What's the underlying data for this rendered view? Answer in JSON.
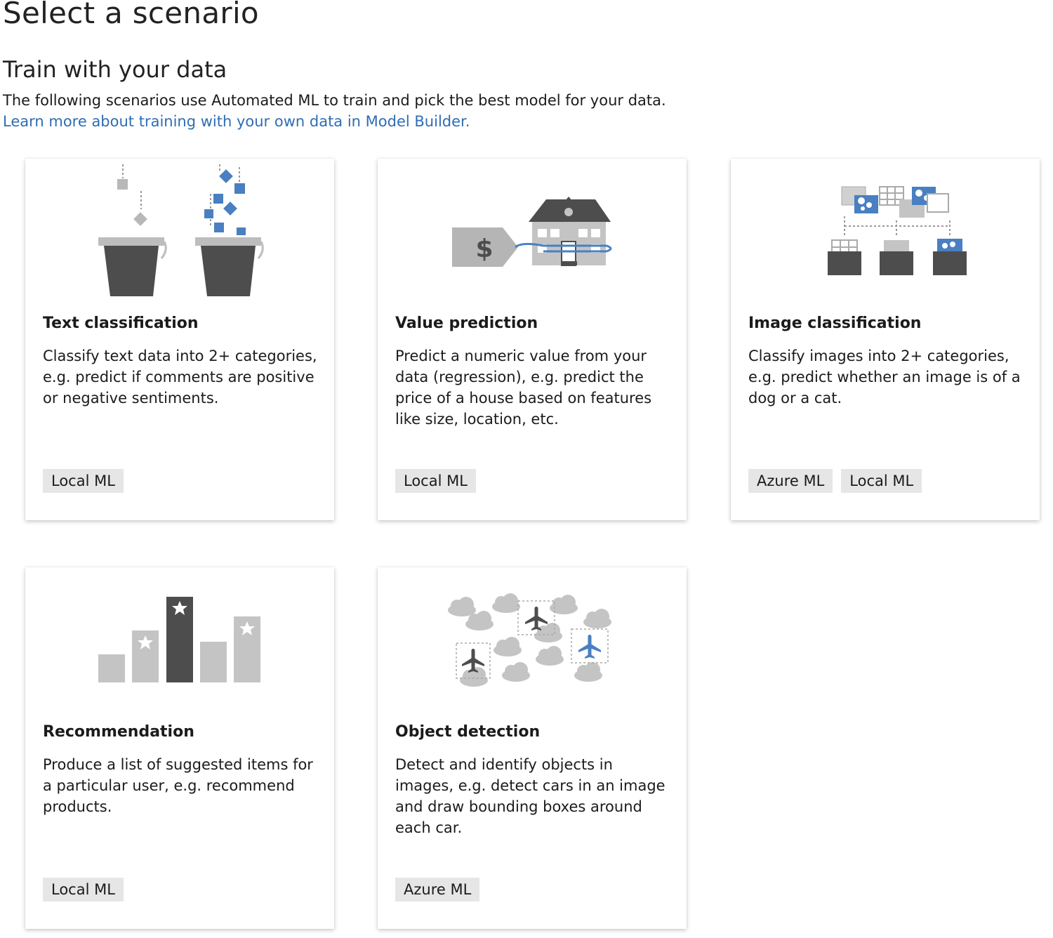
{
  "page": {
    "title": "Select a scenario",
    "section_title": "Train with your data",
    "intro": "The following scenarios use Automated ML to train and pick the best model for your data.",
    "learn_more_link": "Learn more about training with your own data in Model Builder."
  },
  "cards": [
    {
      "title": "Text classification",
      "description": "Classify text data into 2+ categories, e.g. predict if comments are positive or negative sentiments.",
      "tags": [
        "Local ML"
      ],
      "icon": "buckets-icon"
    },
    {
      "title": "Value prediction",
      "description": "Predict a numeric value from your data (regression), e.g. predict the price of a house based on features like size, location, etc.",
      "tags": [
        "Local ML"
      ],
      "icon": "house-price-tag-icon",
      "icon_text": "$"
    },
    {
      "title": "Image classification",
      "description": "Classify images into 2+ categories, e.g. predict whether an image is of a dog or a cat.",
      "tags": [
        "Azure ML",
        "Local ML"
      ],
      "icon": "image-folders-icon"
    },
    {
      "title": "Recommendation",
      "description": "Produce a list of suggested items for a particular user, e.g. recommend products.",
      "tags": [
        "Local ML"
      ],
      "icon": "ranked-bars-icon"
    },
    {
      "title": "Object detection",
      "description": "Detect and identify objects in images, e.g. detect cars in an image and draw bounding boxes around each car.",
      "tags": [
        "Azure ML"
      ],
      "icon": "planes-clouds-icon"
    }
  ],
  "colors": {
    "accent_blue": "#4a7fc1",
    "link_blue": "#2f6db5",
    "dark_gray": "#4d4d4d",
    "mid_gray": "#9a9a9a",
    "light_gray": "#c4c4c4",
    "tag_bg": "#e6e6e6"
  }
}
